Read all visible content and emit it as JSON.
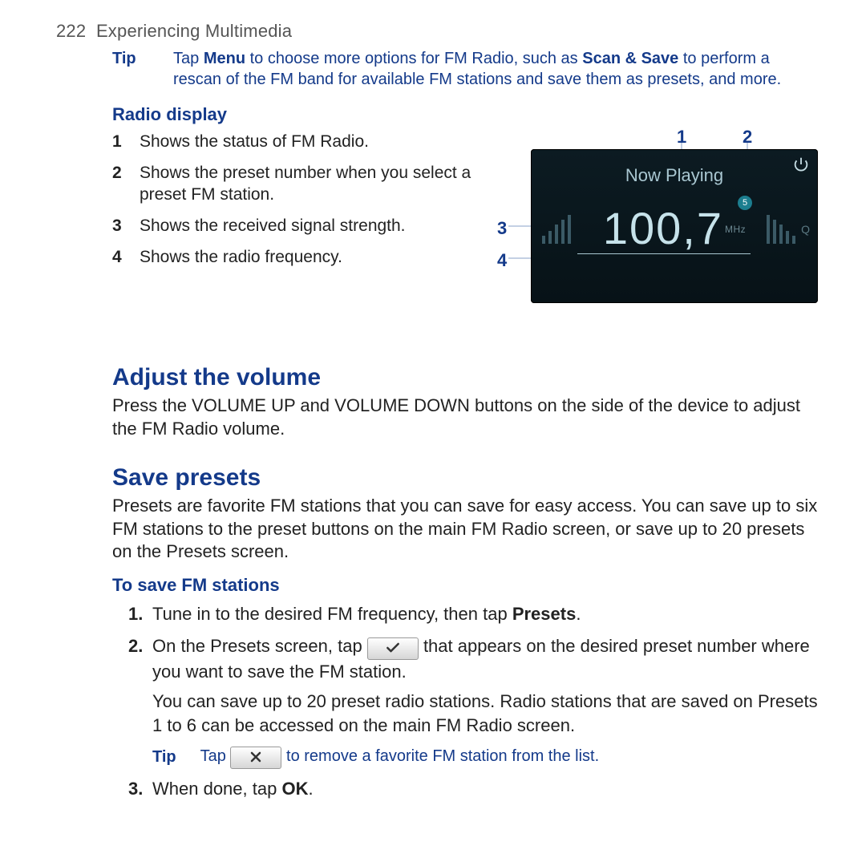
{
  "page": {
    "number": "222",
    "section": "Experiencing Multimedia"
  },
  "top_tip": {
    "label": "Tip",
    "text_1": "Tap ",
    "menu": "Menu",
    "text_2": " to choose more options for FM Radio, such as ",
    "scan": "Scan & Save",
    "text_3": " to perform a rescan of the FM band for available FM stations and save them as presets, and more."
  },
  "radio_display_heading": "Radio display",
  "legend": [
    {
      "n": "1",
      "text": "Shows the status of FM Radio."
    },
    {
      "n": "2",
      "text": "Shows the preset number when you select a preset FM station."
    },
    {
      "n": "3",
      "text": "Shows the received signal strength."
    },
    {
      "n": "4",
      "text": "Shows the radio frequency."
    }
  ],
  "callouts": {
    "c1": "1",
    "c2": "2",
    "c3": "3",
    "c4": "4"
  },
  "radio": {
    "status": "Now Playing",
    "preset": "5",
    "frequency": "100,7",
    "unit": "MHz",
    "q": "Q"
  },
  "adjust_heading": "Adjust the volume",
  "adjust_body": "Press the VOLUME UP and VOLUME DOWN buttons on the side of the device to adjust the FM Radio volume.",
  "save_heading": "Save presets",
  "save_body": "Presets are favorite FM stations that you can save for easy access. You can save up to six FM stations to the preset buttons on the main FM Radio screen, or save up to 20 presets on the Presets screen.",
  "save_sub": "To save FM stations",
  "steps": {
    "s1a": "Tune in to the desired FM frequency, then tap ",
    "s1b": "Presets",
    "s1c": ".",
    "s2a": "On the Presets screen, tap ",
    "s2b": " that appears on the desired preset number where you want to save the FM station.",
    "s2_cont": "You can save up to 20 preset radio stations. Radio stations that are saved on Presets 1 to 6 can be accessed on the main FM Radio screen.",
    "s3a": "When done, tap ",
    "s3b": "OK",
    "s3c": "."
  },
  "inner_tip": {
    "label": "Tip",
    "a": "Tap ",
    "b": " to remove a favorite FM station from the list."
  }
}
